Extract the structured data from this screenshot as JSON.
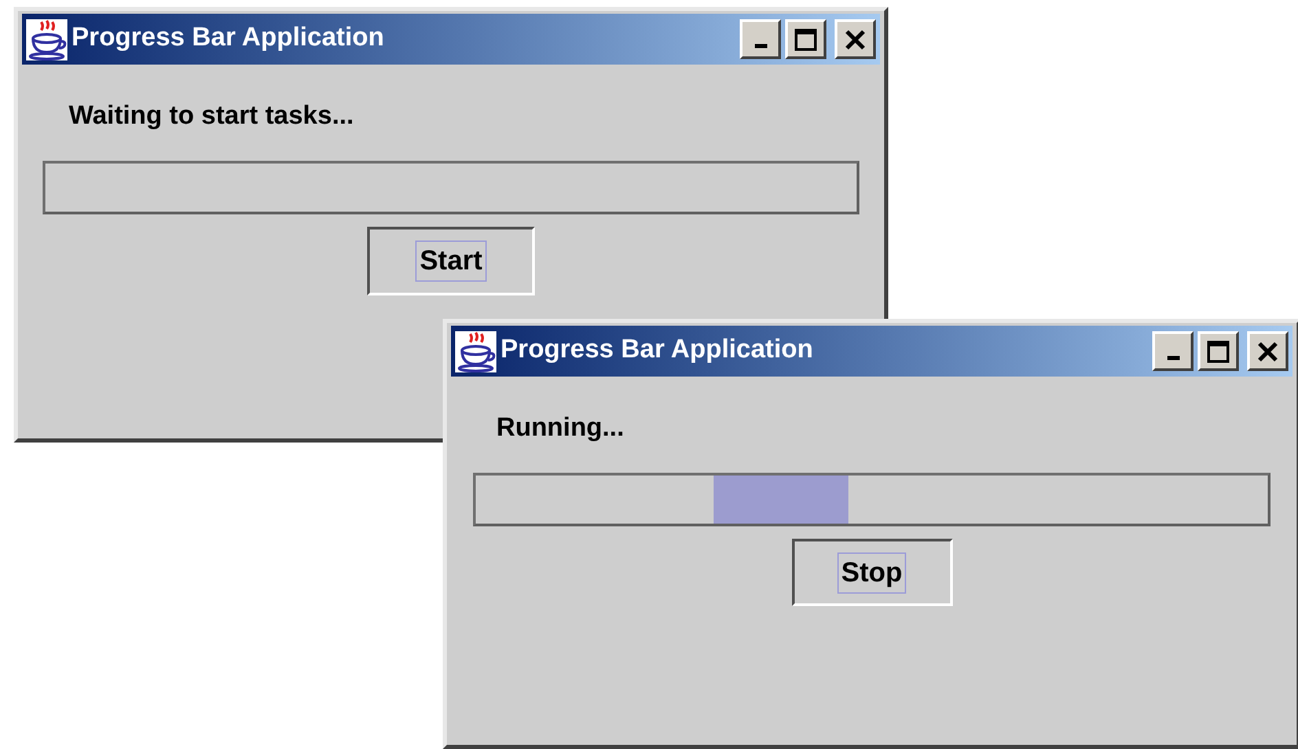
{
  "windows": [
    {
      "title": "Progress Bar Application",
      "status": "Waiting to start tasks...",
      "progress": {
        "indeterminate": false
      },
      "button": "Start",
      "active": true
    },
    {
      "title": "Progress Bar Application",
      "status": "Running...",
      "progress": {
        "indeterminate": true
      },
      "button": "Stop",
      "active": true
    }
  ]
}
